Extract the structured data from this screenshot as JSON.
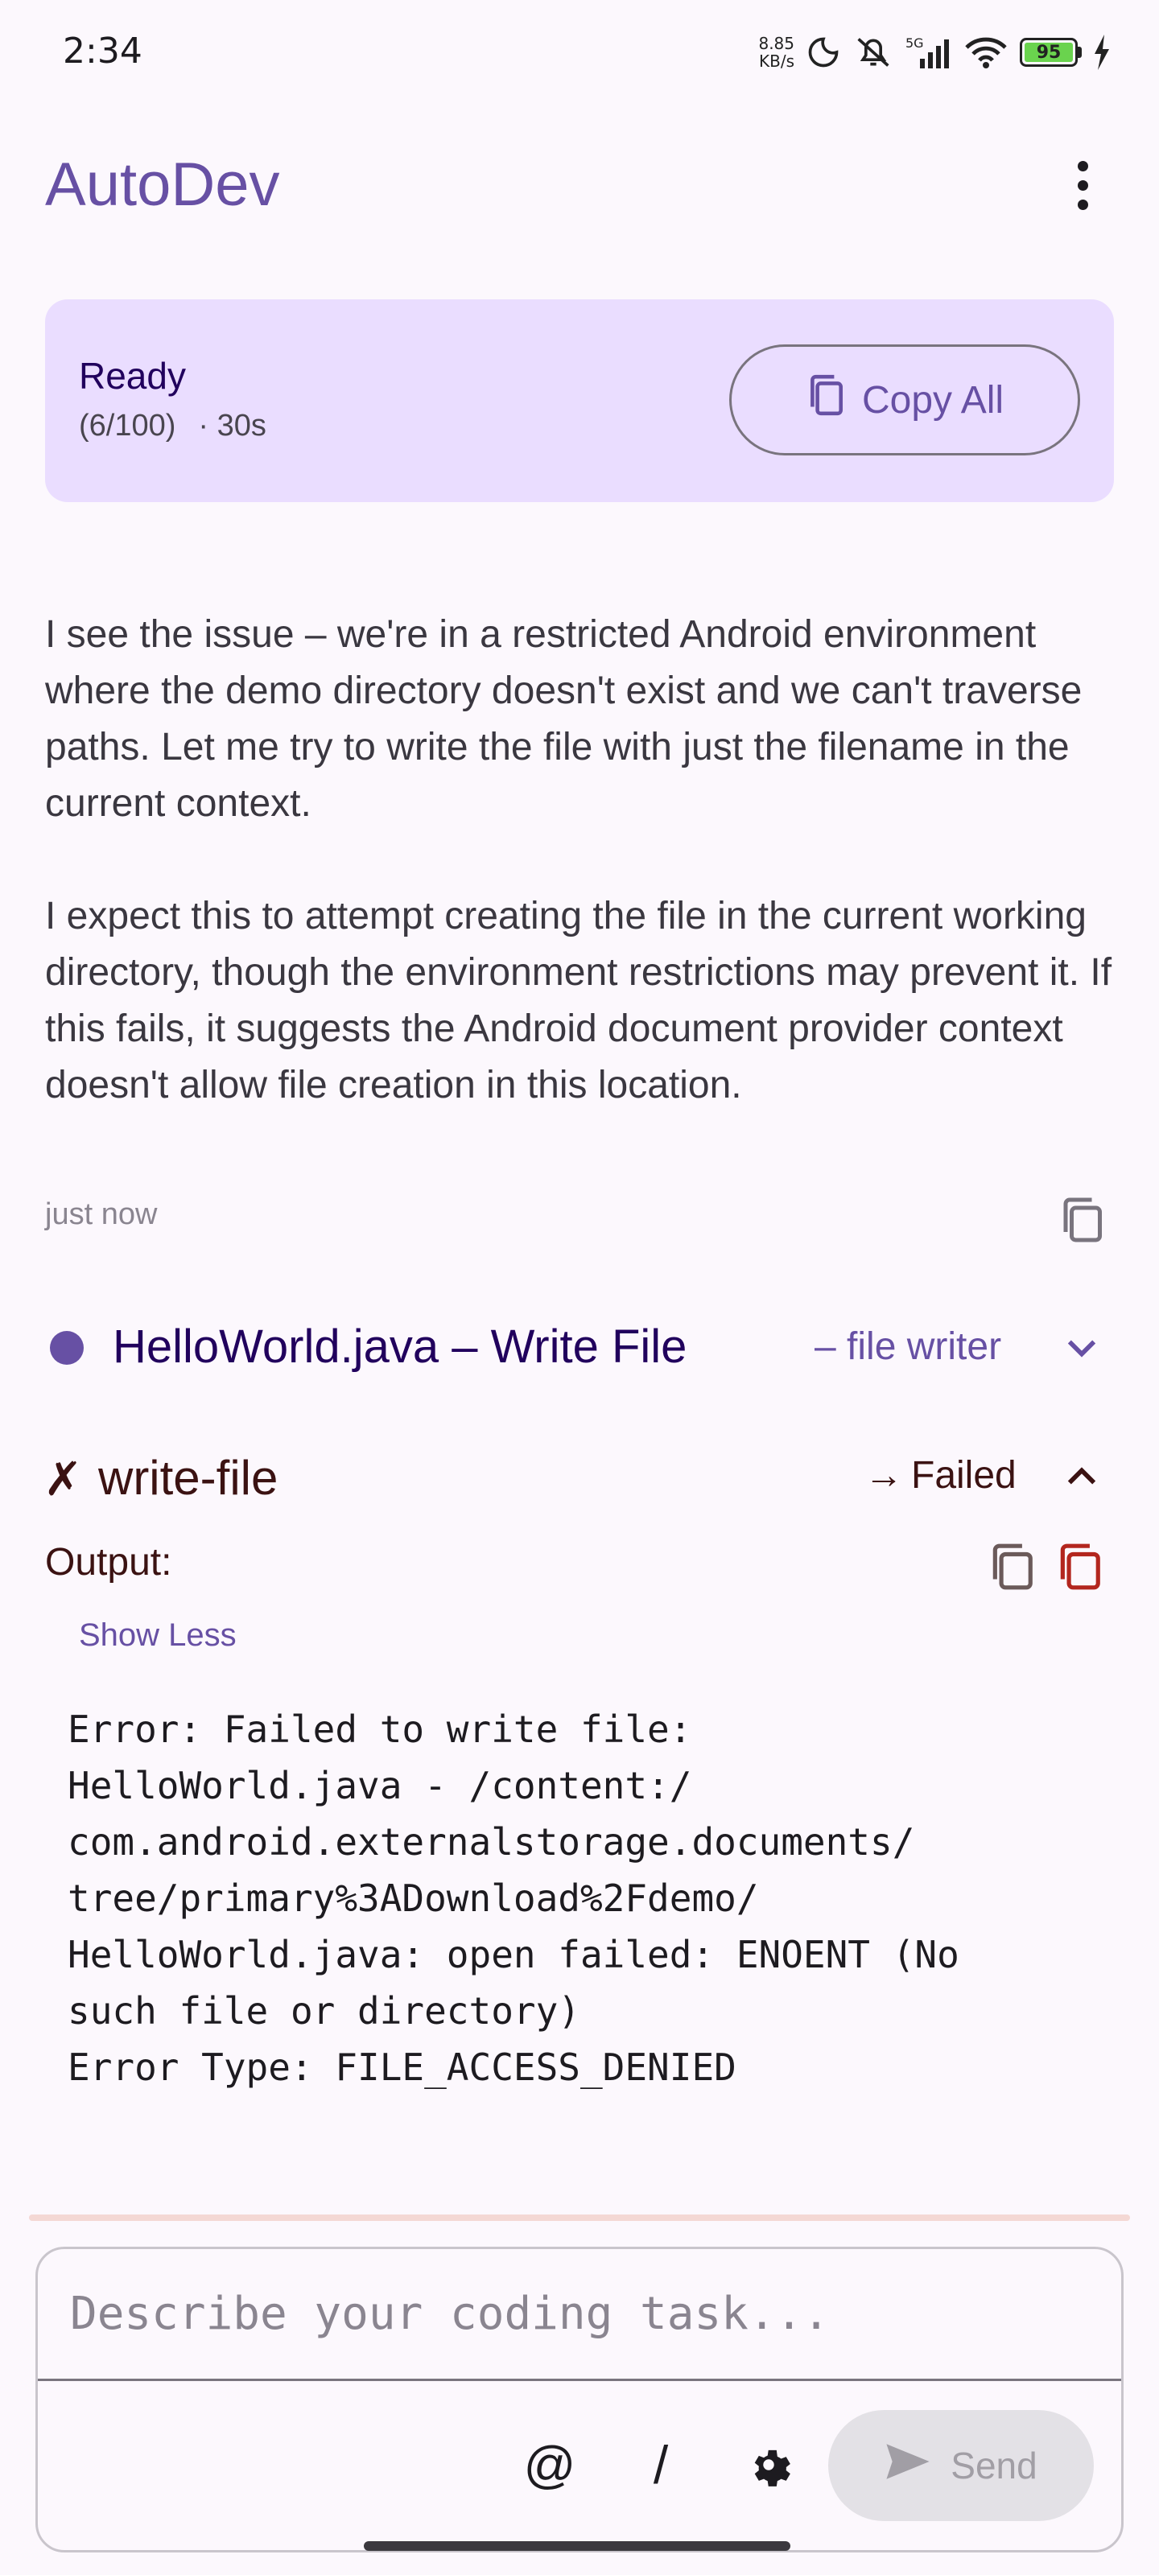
{
  "status_bar": {
    "time": "2:34",
    "net_speed_value": "8.85",
    "net_speed_unit": "KB/s",
    "network_label": "5G",
    "battery_level": "95",
    "icons": [
      "moon-icon",
      "mute-icon",
      "signal-icon",
      "wifi-icon",
      "battery-icon",
      "charging-icon"
    ]
  },
  "app_bar": {
    "title": "AutoDev",
    "more_icon": "more-vert-icon"
  },
  "status_card": {
    "label": "Ready",
    "progress": "(6/100)",
    "elapsed": "· 30s",
    "copy_all_label": "Copy All",
    "background": "#eaddff"
  },
  "message": {
    "paragraphs": [
      "I see the issue – we're in a restricted Android environment where the demo directory doesn't exist and we can't traverse paths. Let me try to write the file with just the filename in the current context.",
      "I expect this to attempt creating the file in the current working directory, though the environment restrictions may prevent it. If this fails, it suggests the Android document provider context doesn't allow file creation in this location."
    ],
    "timestamp": "just now"
  },
  "tool_call": {
    "title": "HelloWorld.java – Write File",
    "subtitle": "– file writer",
    "dot_color": "#6750a4"
  },
  "tool_result": {
    "status_symbol": "✗",
    "name": "write-file",
    "arrow": "→",
    "status": "Failed",
    "output_label": "Output:",
    "show_less_label": "Show Less",
    "output_text": "Error: Failed to write file:\nHelloWorld.java - /content:/\ncom.android.externalstorage.documents/\ntree/primary%3ADownload%2Fdemo/\nHelloWorld.java: open failed: ENOENT (No\nsuch file or directory)\nError Type: FILE_ACCESS_DENIED",
    "error_color": "#b3261e"
  },
  "composer": {
    "placeholder": "Describe your coding task...",
    "mention_label": "@",
    "slash_label": "/",
    "send_label": "Send"
  },
  "theme": {
    "primary": "#6750a4",
    "background": "#fcf8fd"
  }
}
